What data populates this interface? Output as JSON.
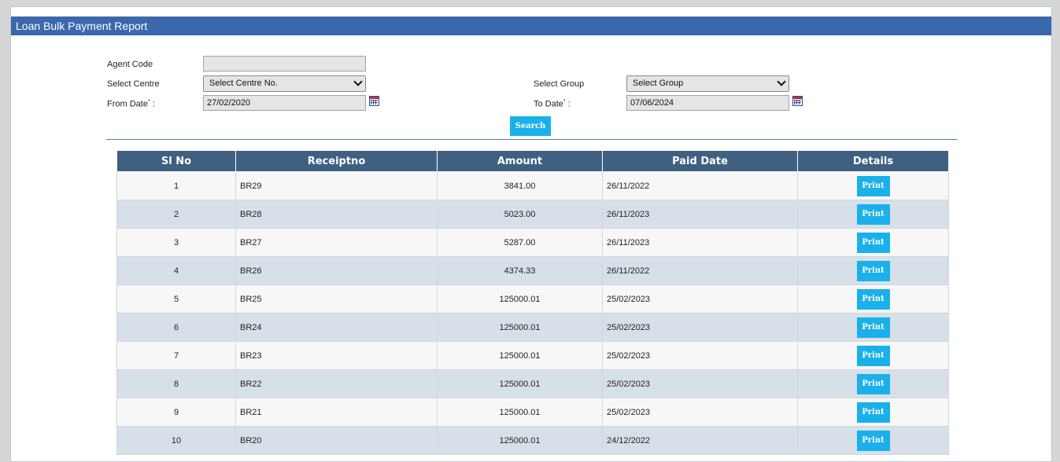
{
  "header": {
    "title": "Loan Bulk Payment Report"
  },
  "form": {
    "agent_code_label": "Agent Code",
    "agent_code_value": "",
    "centre_label": "Select Centre",
    "centre_value": "Select Centre No.",
    "group_label": "Select Group",
    "group_value": "Select Group",
    "from_date_label": "From Date",
    "from_date_value": "27/02/2020",
    "to_date_label": "To Date",
    "to_date_value": "07/06/2024",
    "search_label": "Search"
  },
  "table": {
    "columns": [
      "Sl No",
      "Receiptno",
      "Amount",
      "Paid Date",
      "Details"
    ],
    "print_label": "Print",
    "rows": [
      {
        "sl": "1",
        "receipt": "BR29",
        "amount": "3841.00",
        "date": "26/11/2022"
      },
      {
        "sl": "2",
        "receipt": "BR28",
        "amount": "5023.00",
        "date": "26/11/2023"
      },
      {
        "sl": "3",
        "receipt": "BR27",
        "amount": "5287.00",
        "date": "26/11/2023"
      },
      {
        "sl": "4",
        "receipt": "BR26",
        "amount": "4374.33",
        "date": "26/11/2022"
      },
      {
        "sl": "5",
        "receipt": "BR25",
        "amount": "125000.01",
        "date": "25/02/2023"
      },
      {
        "sl": "6",
        "receipt": "BR24",
        "amount": "125000.01",
        "date": "25/02/2023"
      },
      {
        "sl": "7",
        "receipt": "BR23",
        "amount": "125000.01",
        "date": "25/02/2023"
      },
      {
        "sl": "8",
        "receipt": "BR22",
        "amount": "125000.01",
        "date": "25/02/2023"
      },
      {
        "sl": "9",
        "receipt": "BR21",
        "amount": "125000.01",
        "date": "25/02/2023"
      },
      {
        "sl": "10",
        "receipt": "BR20",
        "amount": "125000.01",
        "date": "24/12/2022"
      }
    ]
  }
}
